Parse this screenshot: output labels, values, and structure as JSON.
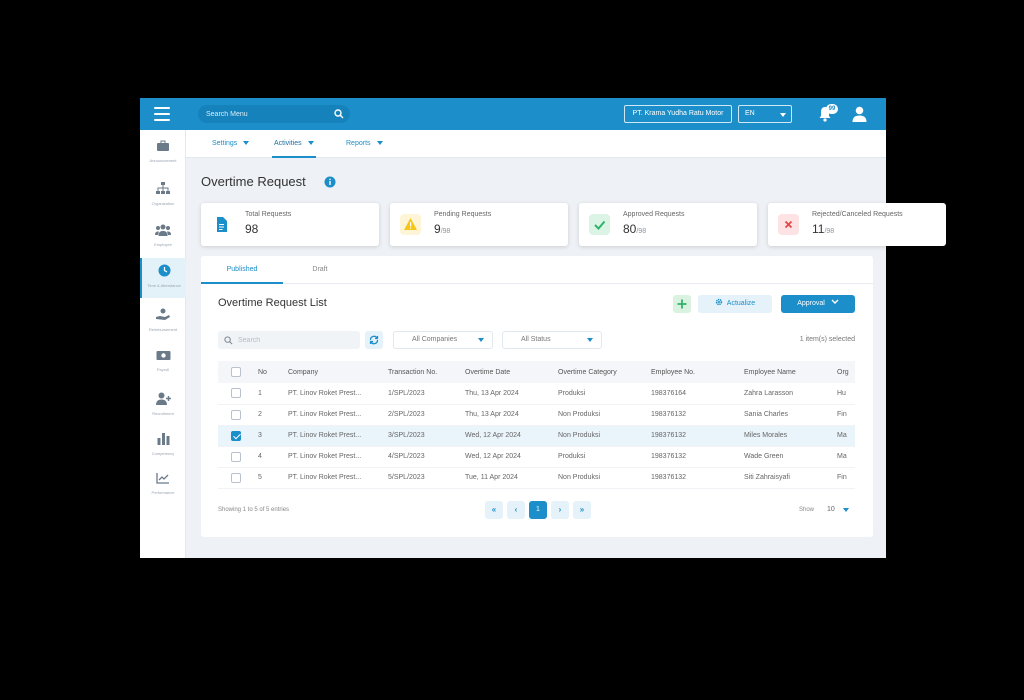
{
  "topbar": {
    "search_placeholder": "Search Menu",
    "company": "PT. Krama Yudha Ratu Motor",
    "language": "EN",
    "notification_count": "99"
  },
  "sidebar": {
    "items": [
      {
        "label": "Announcement",
        "icon": "briefcase-icon"
      },
      {
        "label": "Organization",
        "icon": "org-chart-icon"
      },
      {
        "label": "Employee",
        "icon": "people-icon"
      },
      {
        "label": "Time & Attendance",
        "icon": "clock-icon"
      },
      {
        "label": "Reimbursement",
        "icon": "hand-coin-icon"
      },
      {
        "label": "Payroll",
        "icon": "money-icon"
      },
      {
        "label": "Recruitment",
        "icon": "user-plus-icon"
      },
      {
        "label": "Competency",
        "icon": "bar-chart-icon"
      },
      {
        "label": "Performance",
        "icon": "trend-chart-icon"
      }
    ]
  },
  "subnav": {
    "items": [
      "Settings",
      "Activities",
      "Reports"
    ]
  },
  "page": {
    "title": "Overtime Request"
  },
  "stats": [
    {
      "label": "Total Requests",
      "value": "98",
      "total": ""
    },
    {
      "label": "Pending Requests",
      "value": "9",
      "total": "/98"
    },
    {
      "label": "Approved Requests",
      "value": "80",
      "total": "/98"
    },
    {
      "label": "Rejected/Canceled Requests",
      "value": "11",
      "total": "/98"
    }
  ],
  "tabs": [
    "Published",
    "Draft"
  ],
  "list": {
    "title": "Overtime Request List",
    "actualize_label": "Actualize",
    "approval_label": "Approval",
    "search_placeholder": "Search",
    "company_filter": "All Companies",
    "status_filter": "All Status",
    "selected_text": "1 item(s) selected",
    "columns": [
      "No",
      "Company",
      "Transaction No.",
      "Overtime Date",
      "Overtime Category",
      "Employee No.",
      "Employee Name",
      "Org"
    ],
    "rows": [
      {
        "checked": false,
        "cells": [
          "1",
          "PT. Linov Roket Prest...",
          "1/SPL/2023",
          "Thu, 13 Apr 2024",
          "Produksi",
          "198376164",
          "Zahra Larasson",
          "Hu"
        ]
      },
      {
        "checked": false,
        "cells": [
          "2",
          "PT. Linov Roket Prest...",
          "2/SPL/2023",
          "Thu, 13 Apr 2024",
          "Non Produksi",
          "198376132",
          "Sania Charles",
          "Fin"
        ]
      },
      {
        "checked": true,
        "cells": [
          "3",
          "PT. Linov Roket Prest...",
          "3/SPL/2023",
          "Wed, 12 Apr 2024",
          "Non Produksi",
          "198376132",
          "Miles Morales",
          "Ma"
        ]
      },
      {
        "checked": false,
        "cells": [
          "4",
          "PT. Linov Roket Prest...",
          "4/SPL/2023",
          "Wed, 12 Apr 2024",
          "Produksi",
          "198376132",
          "Wade Green",
          "Ma"
        ]
      },
      {
        "checked": false,
        "cells": [
          "5",
          "PT. Linov Roket Prest...",
          "5/SPL/2023",
          "Tue, 11 Apr 2024",
          "Non Produksi",
          "198376132",
          "Siti Zahraisyafi",
          "Fin"
        ]
      }
    ],
    "showing_text": "Showing 1 to 5 of 5 entries",
    "current_page": "1",
    "show_label": "Show",
    "page_size": "10"
  },
  "colors": {
    "primary": "#1c8ec9",
    "pending": "#f5c518",
    "approved": "#2fb36b",
    "rejected": "#e54848"
  }
}
